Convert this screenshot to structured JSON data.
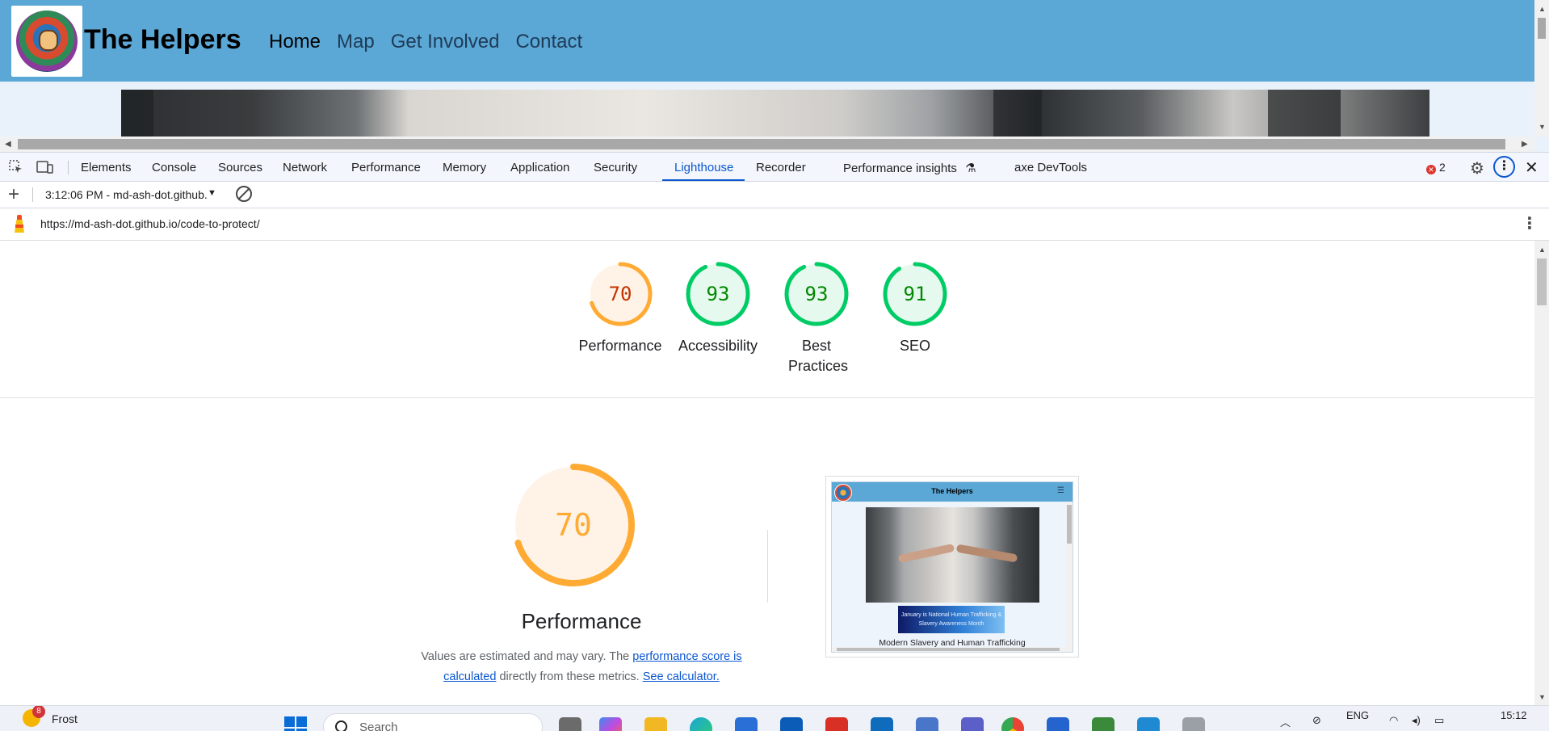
{
  "site": {
    "title": "The Helpers",
    "nav": [
      "Home",
      "Map",
      "Get Involved",
      "Contact"
    ]
  },
  "devtools": {
    "tabs": [
      "Elements",
      "Console",
      "Sources",
      "Network",
      "Performance",
      "Memory",
      "Application",
      "Security",
      "Lighthouse",
      "Recorder",
      "Performance insights",
      "axe DevTools"
    ],
    "active_tab": "Lighthouse",
    "error_count": "2",
    "icons": [
      "inspect-element-icon",
      "device-toolbar-icon",
      "settings-gear-icon",
      "more-options-icon",
      "close-icon",
      "experiment-flask-icon"
    ]
  },
  "lighthouse": {
    "report_select": "3:12:06 PM - md-ash-dot.github.io",
    "url": "https://md-ash-dot.github.io/code-to-protect/",
    "scores": [
      {
        "label": "Performance",
        "value": 70,
        "status": "average"
      },
      {
        "label": "Accessibility",
        "value": 93,
        "status": "pass"
      },
      {
        "label": "Best Practices",
        "value": 93,
        "status": "pass"
      },
      {
        "label": "SEO",
        "value": 91,
        "status": "pass"
      }
    ],
    "colors": {
      "average": "#fa3",
      "average_text": "#c33300",
      "average_bg": "#fff3e8",
      "pass": "#0c6",
      "pass_text": "#008800",
      "pass_bg": "#e6f9ee"
    },
    "performance": {
      "score": 70,
      "title": "Performance",
      "desc_prefix": "Values are estimated and may vary. The ",
      "desc_link": "performance score is calculated",
      "desc_middle": " directly from these metrics. ",
      "desc_link2": "See calculator."
    },
    "screenshot": {
      "title": "The Helpers",
      "banner": "January is National Human Trafficking & Slavery Awareness Month",
      "caption": "Modern Slavery and Human Trafficking"
    }
  },
  "taskbar": {
    "weather_text": "Frost",
    "notification_count": "8",
    "search_placeholder": "Search",
    "language": "ENG",
    "time": "15:12"
  }
}
